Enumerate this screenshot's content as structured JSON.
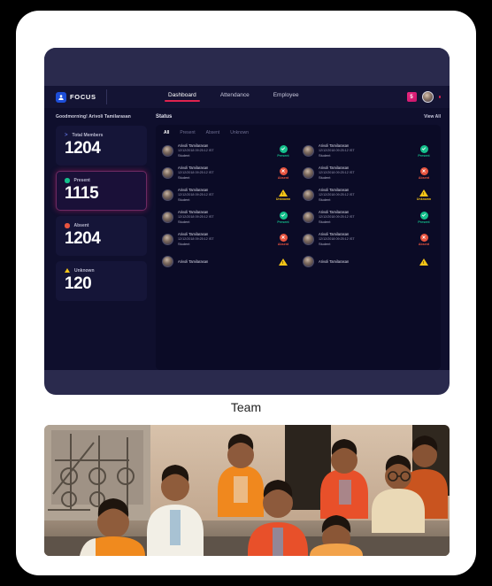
{
  "app": {
    "brand_name": "FOCUS",
    "brand_icon": "person-badge-icon"
  },
  "nav": {
    "tabs": [
      {
        "label": "Dashboard",
        "active": true
      },
      {
        "label": "Attendance",
        "active": false
      },
      {
        "label": "Employee",
        "active": false
      }
    ],
    "notification_count": "5",
    "avatar_icon": "user-avatar"
  },
  "sidebar": {
    "greeting": "Goodmorning! Arivoli Tamilarasan",
    "cards": [
      {
        "label": "Total Members",
        "value": "1204",
        "icon": "chevron-right-icon",
        "highlight": false
      },
      {
        "label": "Present",
        "value": "1115",
        "icon": "green-dot-icon",
        "highlight": true
      },
      {
        "label": "Absent",
        "value": "1204",
        "icon": "red-dot-icon",
        "highlight": false
      },
      {
        "label": "Unknown",
        "value": "120",
        "icon": "warning-triangle-icon",
        "highlight": false
      }
    ]
  },
  "status_panel": {
    "title": "Status",
    "view_all": "View All",
    "filters": [
      {
        "label": "All",
        "active": true
      },
      {
        "label": "Present",
        "active": false
      },
      {
        "label": "Absent",
        "active": false
      },
      {
        "label": "Unknown",
        "active": false
      }
    ],
    "rows": [
      {
        "name": "Arivoli Tamilarasan",
        "date": "12/12/2018",
        "time": "09:25:12 IST",
        "role": "Student",
        "status": "Present"
      },
      {
        "name": "Arivoli Tamilarasan",
        "date": "12/12/2018",
        "time": "09:25:12 IST",
        "role": "Student",
        "status": "Present"
      },
      {
        "name": "Arivoli Tamilarasan",
        "date": "12/12/2018",
        "time": "09:25:12 IST",
        "role": "Student",
        "status": "Absent"
      },
      {
        "name": "Arivoli Tamilarasan",
        "date": "12/12/2018",
        "time": "09:25:12 IST",
        "role": "Student",
        "status": "Absent"
      },
      {
        "name": "Arivoli Tamilarasan",
        "date": "12/12/2018",
        "time": "09:25:12 IST",
        "role": "Student",
        "status": "Unknown"
      },
      {
        "name": "Arivoli Tamilarasan",
        "date": "12/12/2018",
        "time": "09:25:12 IST",
        "role": "Student",
        "status": "Unknown"
      },
      {
        "name": "Arivoli Tamilarasan",
        "date": "12/12/2018",
        "time": "09:25:12 IST",
        "role": "Student",
        "status": "Present"
      },
      {
        "name": "Arivoli Tamilarasan",
        "date": "12/12/2018",
        "time": "09:25:12 IST",
        "role": "Student",
        "status": "Present"
      },
      {
        "name": "Arivoli Tamilarasan",
        "date": "12/12/2018",
        "time": "09:25:12 IST",
        "role": "Student",
        "status": "Absent"
      },
      {
        "name": "Arivoli Tamilarasan",
        "date": "12/12/2018",
        "time": "09:25:12 IST",
        "role": "Student",
        "status": "Absent"
      },
      {
        "name": "Arivoli Tamilarasan",
        "date": "",
        "time": "",
        "role": "",
        "status": "Unknown"
      },
      {
        "name": "Arivoli Tamilarasan",
        "date": "",
        "time": "",
        "role": "",
        "status": "Unknown"
      }
    ]
  },
  "team_section": {
    "title": "Team",
    "photo_alt": "group-team-photo"
  },
  "colors": {
    "present": "#15c08c",
    "absent": "#e8543f",
    "unknown": "#f5c518",
    "accent": "#e0234e",
    "badge_pink": "#e8267f",
    "panel_dark": "#0f0f2d",
    "frame_navy": "#2a2a4d"
  }
}
